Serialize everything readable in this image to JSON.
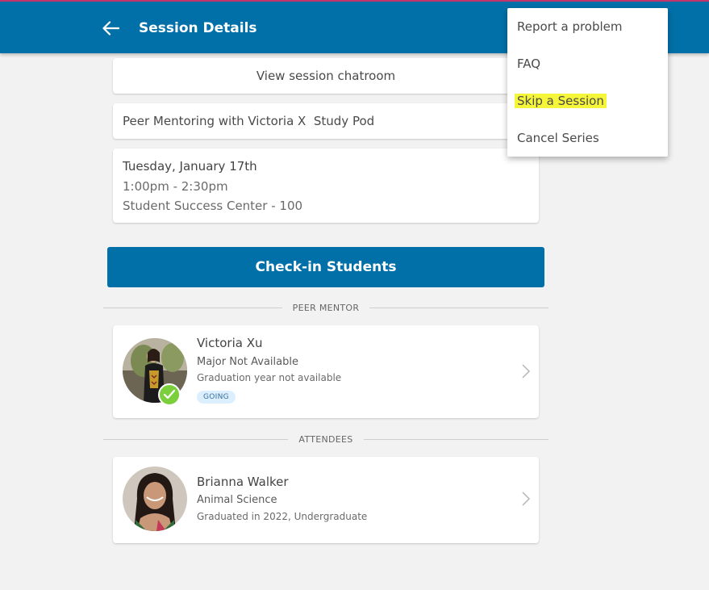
{
  "header": {
    "title": "Session Details",
    "back_icon": "arrow-left-icon",
    "background": "#0270a8",
    "accent_top": "#c3356a"
  },
  "session": {
    "chatroom_label": "View session chatroom",
    "name": "Peer Mentoring with Victoria X  Study Pod",
    "date": "Tuesday, January 17th",
    "time": "1:00pm - 2:30pm",
    "location": "Student Success Center - 100"
  },
  "checkin_label": "Check-in Students",
  "sections": {
    "peer_mentor": "PEER MENTOR",
    "attendees": "ATTENDEES"
  },
  "peer_mentor": {
    "name": "Victoria Xu",
    "major": "Major Not Available",
    "graduation": "Graduation year not available",
    "status": "GOING",
    "checked_icon": "check-circle-icon"
  },
  "attendees": [
    {
      "name": "Brianna Walker",
      "major": "Animal Science",
      "graduation": "Graduated in 2022, Undergraduate"
    }
  ],
  "menu": {
    "items": [
      {
        "label": "Report a problem"
      },
      {
        "label": "FAQ"
      },
      {
        "label": "Skip a Session",
        "highlighted": true
      },
      {
        "label": "Cancel Series"
      }
    ],
    "highlight_color": "#f5f53a"
  },
  "colors": {
    "primary": "#0270a8",
    "check_green": "#7ccf3c",
    "badge_bg": "#dcefff"
  }
}
